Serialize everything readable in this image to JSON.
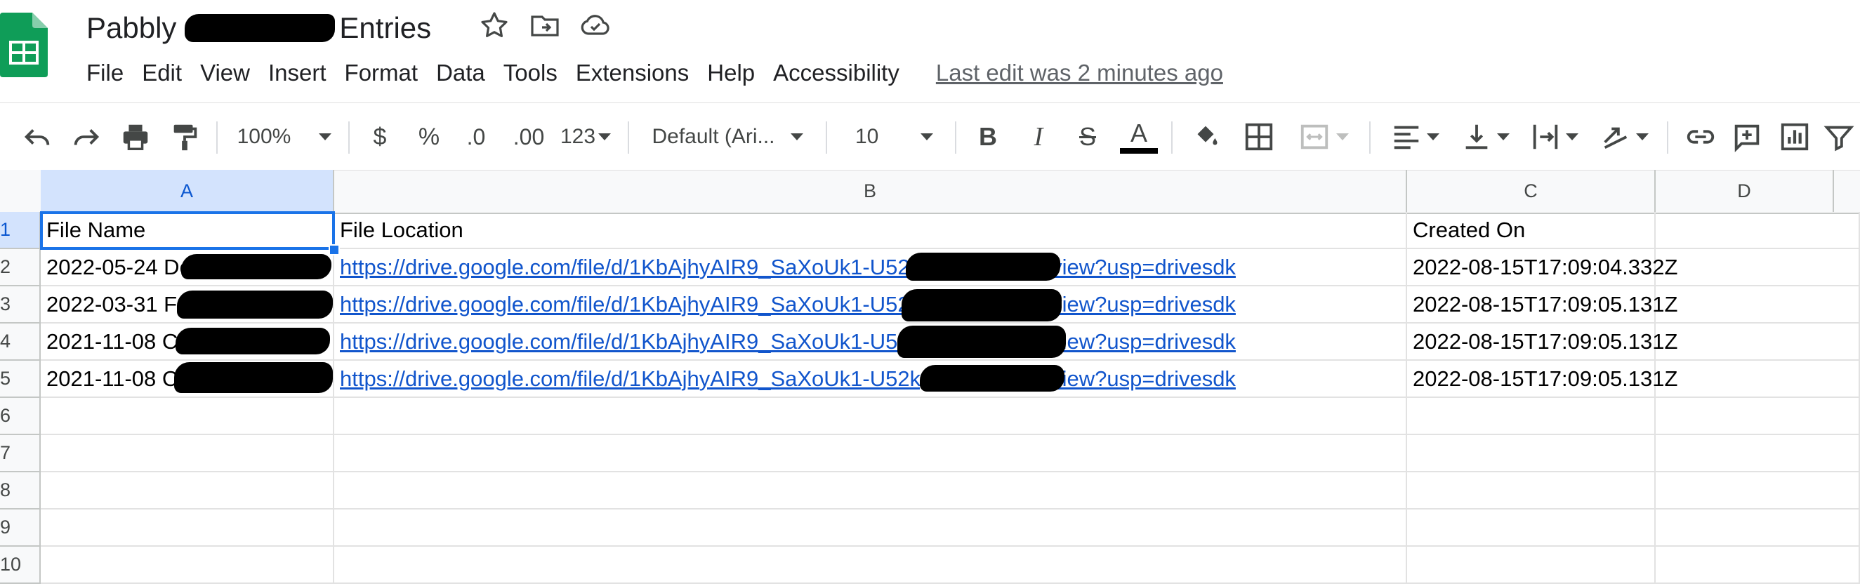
{
  "document": {
    "title_prefix": "Pabbly",
    "title_suffix": "Entries"
  },
  "menu": [
    "File",
    "Edit",
    "View",
    "Insert",
    "Format",
    "Data",
    "Tools",
    "Extensions",
    "Help",
    "Accessibility"
  ],
  "last_edit": "Last edit was 2 minutes ago",
  "toolbar": {
    "zoom": "100%",
    "currency": "$",
    "percent": "%",
    "decrease_decimal": ".0",
    "increase_decimal": ".00",
    "number_format": "123",
    "font": "Default (Ari...",
    "font_size": "10",
    "bold": "B",
    "italic": "I",
    "strike": "S",
    "text_color": "A"
  },
  "columns": [
    "A",
    "B",
    "C",
    "D"
  ],
  "rows": [
    "1",
    "2",
    "3",
    "4",
    "5",
    "6",
    "7",
    "8",
    "9",
    "10"
  ],
  "sheet": {
    "headers": [
      "File Name",
      "File Location",
      "Created On"
    ],
    "records": [
      {
        "name": "2022-05-24 Dollarama Coto",
        "url": "https://drive.google.com/file/d/1KbAjhyAIR9_SaXoUk1-U52kgAu0QOrmY/view?usp=drivesdk",
        "created": "2022-08-15T17:09:04.332Z"
      },
      {
        "name": "2022-03-31 F",
        "url": "https://drive.google.com/file/d/1KbAjhyAIR9_SaXoUk1-U52kgAu0QOrmY/view?usp=drivesdk",
        "created": "2022-08-15T17:09:05.131Z"
      },
      {
        "name": "2021-11-08 Car Windshield",
        "url": "https://drive.google.com/file/d/1KbAjhyAIR9_SaXoUk1-U52kgAu0QOrmY/view?usp=drivesdk",
        "created": "2022-08-15T17:09:05.131Z"
      },
      {
        "name": "2021-11-08 Car Windshield",
        "url": "https://drive.google.com/file/d/1KbAjhyAIR9_SaXoUk1-U52kgAu0QOrmY/view?usp=drivesdk",
        "created": "2022-08-15T17:09:05.131Z"
      }
    ]
  },
  "colors": {
    "sheets_green": "#0f9d58",
    "link_blue": "#1155cc",
    "selection_blue": "#1a73e8"
  }
}
